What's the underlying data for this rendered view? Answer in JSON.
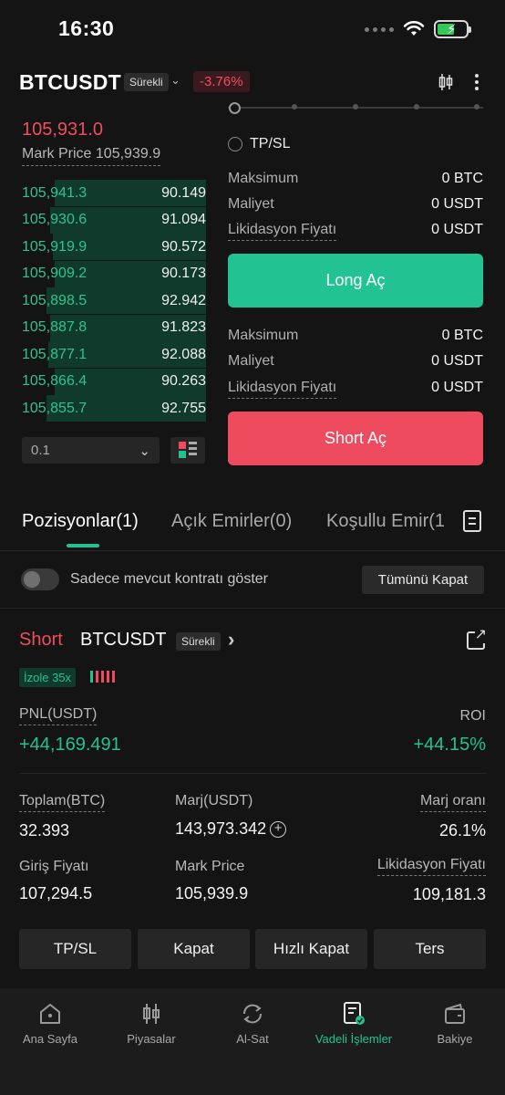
{
  "status_bar": {
    "time": "16:30"
  },
  "header": {
    "symbol": "BTCUSDT",
    "contract_type": "Sürekli",
    "change": "-3.76%"
  },
  "orderbook": {
    "last_price": "105,931.0",
    "mark_price_label": "Mark Price",
    "mark_price": "105,939.9",
    "bids": [
      {
        "price": "105,941.3",
        "qty": "90.149",
        "depth": 0.8
      },
      {
        "price": "105,930.6",
        "qty": "91.094",
        "depth": 0.82
      },
      {
        "price": "105,919.9",
        "qty": "90.572",
        "depth": 0.81
      },
      {
        "price": "105,909.2",
        "qty": "90.173",
        "depth": 0.8
      },
      {
        "price": "105,898.5",
        "qty": "92.942",
        "depth": 0.84
      },
      {
        "price": "105,887.8",
        "qty": "91.823",
        "depth": 0.82
      },
      {
        "price": "105,877.1",
        "qty": "92.088",
        "depth": 0.83
      },
      {
        "price": "105,866.4",
        "qty": "90.263",
        "depth": 0.8
      },
      {
        "price": "105,855.7",
        "qty": "92.755",
        "depth": 0.84
      }
    ],
    "precision": "0.1"
  },
  "trade": {
    "tpsl_label": "TP/SL",
    "long_info": {
      "max_label": "Maksimum",
      "max_val": "0 BTC",
      "cost_label": "Maliyet",
      "cost_val": "0 USDT",
      "liq_label": "Likidasyon Fiyatı",
      "liq_val": "0 USDT"
    },
    "long_button": "Long Aç",
    "short_info": {
      "max_label": "Maksimum",
      "max_val": "0 BTC",
      "cost_label": "Maliyet",
      "cost_val": "0 USDT",
      "liq_label": "Likidasyon Fiyatı",
      "liq_val": "0 USDT"
    },
    "short_button": "Short Aç"
  },
  "tabs": [
    "Pozisyonlar(1)",
    "Açık Emirler(0)",
    "Koşullu Emir(1"
  ],
  "filter": {
    "toggle_label": "Sadece mevcut kontratı göster",
    "close_all": "Tümünü Kapat"
  },
  "position": {
    "side": "Short",
    "symbol": "BTCUSDT",
    "contract_type": "Sürekli",
    "margin_mode": "İzole 35x",
    "pnl_label": "PNL(USDT)",
    "pnl": "+44,169.491",
    "roi_label": "ROI",
    "roi": "+44.15%",
    "size_label": "Toplam(BTC)",
    "size": "32.393",
    "margin_label": "Marj(USDT)",
    "margin": "143,973.342",
    "margin_ratio_label": "Marj oranı",
    "margin_ratio": "26.1%",
    "entry_label": "Giriş Fiyatı",
    "entry": "107,294.5",
    "mark_label": "Mark Price",
    "mark": "105,939.9",
    "liq_label": "Likidasyon Fiyatı",
    "liq": "109,181.3",
    "actions": [
      "TP/SL",
      "Kapat",
      "Hızlı Kapat",
      "Ters"
    ]
  },
  "bottom_nav": [
    {
      "label": "Ana Sayfa",
      "icon": "home-icon"
    },
    {
      "label": "Piyasalar",
      "icon": "candles-icon"
    },
    {
      "label": "Al-Sat",
      "icon": "swap-icon"
    },
    {
      "label": "Vadeli İşlemler",
      "icon": "futures-icon"
    },
    {
      "label": "Bakiye",
      "icon": "wallet-icon"
    }
  ],
  "colors": {
    "green": "#22c292",
    "red": "#ef4b5f",
    "background": "#141414"
  }
}
